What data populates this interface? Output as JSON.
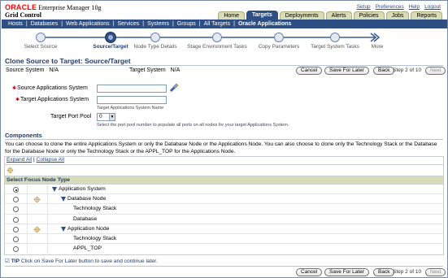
{
  "brand": {
    "oracle": "ORACLE",
    "product": "Enterprise Manager 10g",
    "subtitle": "Grid Control"
  },
  "global_links": [
    "Setup",
    "Preferences",
    "Help",
    "Logout"
  ],
  "tabs": [
    {
      "label": "Home",
      "active": false
    },
    {
      "label": "Targets",
      "active": true
    },
    {
      "label": "Deployments",
      "active": false
    },
    {
      "label": "Alerts",
      "active": false
    },
    {
      "label": "Policies",
      "active": false
    },
    {
      "label": "Jobs",
      "active": false
    },
    {
      "label": "Reports",
      "active": false
    }
  ],
  "subnav": [
    "Hosts",
    "Databases",
    "Web Applications",
    "Services",
    "Systems",
    "Groups",
    "All Targets",
    "Oracle Applications"
  ],
  "train": {
    "steps": [
      "Select Source",
      "Source/Target",
      "Node Type Details",
      "Stage Environment Tasks",
      "Copy Parameters",
      "Target System Tasks",
      "More"
    ],
    "current_index": 1
  },
  "page": {
    "title": "Clone Source to Target: Source/Target",
    "source_system_label": "Source System",
    "source_system_value": "N/A",
    "target_system_label": "Target System",
    "target_system_value": "N/A"
  },
  "actions": {
    "cancel": "Cancel",
    "save_later": "Save For Later",
    "back": "Back",
    "step": "Step 2 of 10",
    "next": "Next"
  },
  "form": {
    "source_app_label": "Source Applications System",
    "source_app_value": "",
    "target_app_label": "Target Applications System",
    "target_app_value": "",
    "target_app_hint": "Target Applications System Name",
    "port_pool_label": "Target Port Pool",
    "port_pool_value": "0",
    "port_pool_hint": "Select the port pool number to populate all ports on all nodes for your target Applications System."
  },
  "components": {
    "heading": "Components",
    "description": "You can choose to clone the entire Applications System or only the Database Node or the Applications Node. You can also choose to clone only the Technology Stack or the Database for the Database Node or only the Technology Stack or the APPL_TOP for the Applications Node.",
    "expand_all": "Expand All",
    "collapse_all": "Collapse All",
    "column_header": "Select Focus Node Type",
    "rows": [
      {
        "label": "Application System",
        "level": 0,
        "expandable": true,
        "focus": false,
        "selected": true
      },
      {
        "label": "Database Node",
        "level": 1,
        "expandable": true,
        "focus": true,
        "selected": false
      },
      {
        "label": "Technology Stack",
        "level": 2,
        "expandable": false,
        "focus": false,
        "selected": false
      },
      {
        "label": "Database",
        "level": 2,
        "expandable": false,
        "focus": false,
        "selected": false
      },
      {
        "label": "Application Node",
        "level": 1,
        "expandable": true,
        "focus": true,
        "selected": false
      },
      {
        "label": "Technology Stack",
        "level": 2,
        "expandable": false,
        "focus": false,
        "selected": false
      },
      {
        "label": "APPL_TOP",
        "level": 2,
        "expandable": false,
        "focus": false,
        "selected": false
      }
    ]
  },
  "tip": {
    "prefix": "TIP",
    "text": "Click on Save For Later button to save and continue later."
  },
  "colors": {
    "nav_blue": "#2e4f83",
    "title_blue": "#223b6a",
    "tab_khaki": "#d9dcb6",
    "header_khaki": "#d8dcb8",
    "oracle_red": "#ff0000"
  }
}
